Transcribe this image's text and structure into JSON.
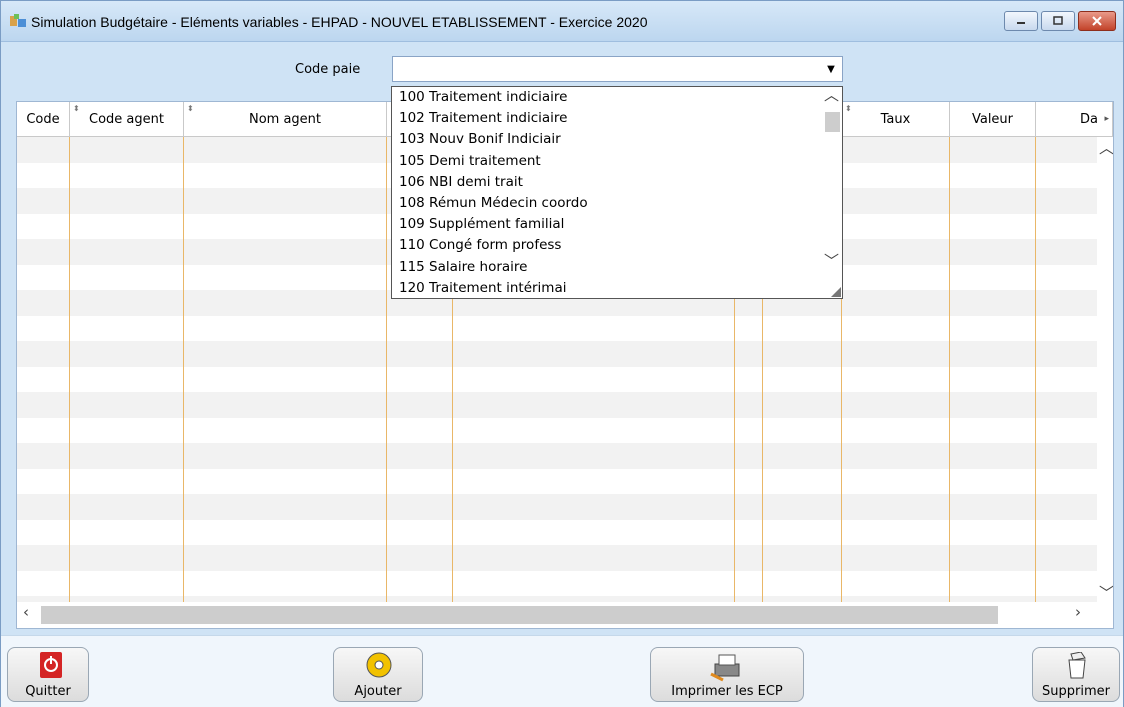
{
  "window": {
    "title": "Simulation Budgétaire - Eléments variables -  EHPAD  -  NOUVEL ETABLISSEMENT  -  Exercice  2020",
    "icon": "app-budget-icon",
    "buttons": [
      "minimize-icon",
      "maximize-icon",
      "close-icon"
    ]
  },
  "filter": {
    "label": "Code paie",
    "value": ""
  },
  "table": {
    "columns": [
      {
        "label": "Code"
      },
      {
        "label": "Code agent"
      },
      {
        "label": "Nom agent"
      },
      {
        "label": ""
      },
      {
        "label": ""
      },
      {
        "label": ""
      },
      {
        "label": "Taux"
      },
      {
        "label": "Valeur"
      },
      {
        "label": "Da"
      }
    ],
    "rows": []
  },
  "dropdown": {
    "options": [
      "100 Traitement indiciaire",
      "102 Traitement indiciaire",
      "103 Nouv Bonif Indiciair",
      "105 Demi traitement",
      "106 NBI demi trait",
      "108 Rémun Médecin coordo",
      "109 Supplément familial",
      "110 Congé form profess",
      "115 Salaire horaire",
      "120 Traitement intérimai"
    ]
  },
  "footer": {
    "quit_label": "Quitter",
    "add_label": "Ajouter",
    "print_label": "Imprimer les ECP",
    "delete_label": "Supprimer"
  },
  "colors": {
    "title_bg": "#bcd6ef",
    "column_line": "#e9b768",
    "row_alt": "#f2f2f2"
  }
}
